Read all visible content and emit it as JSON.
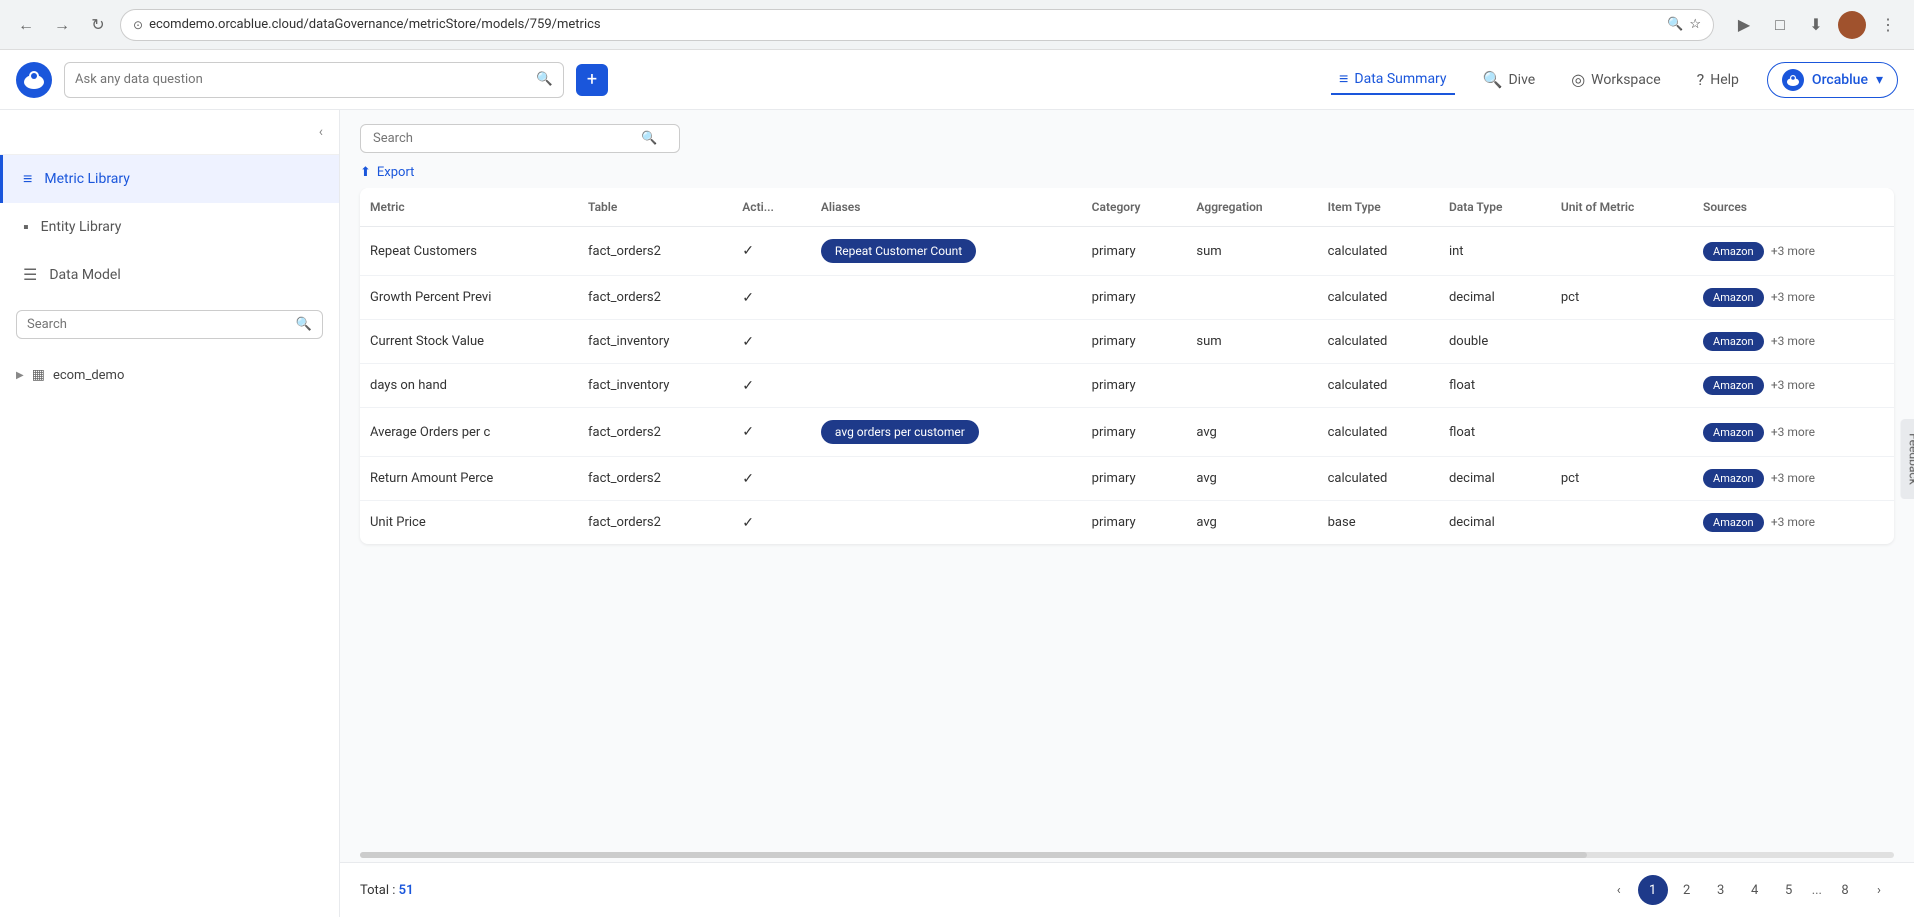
{
  "browser": {
    "url": "ecomdemo.orcablue.cloud/dataGovernance/metricStore/models/759/metrics",
    "back_label": "←",
    "forward_label": "→",
    "reload_label": "↻"
  },
  "header": {
    "search_placeholder": "Ask any data question",
    "nav": {
      "data_summary": "Data Summary",
      "dive": "Dive",
      "workspace": "Workspace",
      "help": "Help",
      "orcablue": "Orcablue"
    }
  },
  "sidebar": {
    "collapse_icon": "‹",
    "nav_items": [
      {
        "id": "metric-library",
        "label": "Metric Library",
        "icon": "≡",
        "active": true
      },
      {
        "id": "entity-library",
        "label": "Entity Library",
        "icon": "▪",
        "active": false
      },
      {
        "id": "data-model",
        "label": "Data Model",
        "icon": "☰",
        "active": false
      }
    ],
    "search_placeholder": "Search",
    "tree": {
      "item_label": "ecom_demo",
      "item_icon": "▦",
      "expand_icon": "▶"
    }
  },
  "content": {
    "search_placeholder": "Search",
    "export_label": "Export",
    "columns": [
      "Metric",
      "Table",
      "Acti...",
      "Aliases",
      "Category",
      "Aggregation",
      "Item Type",
      "Data Type",
      "Unit of Metric",
      "Sources"
    ],
    "rows": [
      {
        "metric": "Repeat Customers",
        "table": "fact_orders2",
        "active": true,
        "alias": "Repeat Customer Count",
        "category": "primary",
        "aggregation": "sum",
        "item_type": "calculated",
        "data_type": "int",
        "unit": "",
        "source": "Amazon",
        "more": "+3 more"
      },
      {
        "metric": "Growth Percent Previ",
        "table": "fact_orders2",
        "active": true,
        "alias": "",
        "category": "primary",
        "aggregation": "",
        "item_type": "calculated",
        "data_type": "decimal",
        "unit": "pct",
        "source": "Amazon",
        "more": "+3 more"
      },
      {
        "metric": "Current Stock Value",
        "table": "fact_inventory",
        "active": true,
        "alias": "",
        "category": "primary",
        "aggregation": "sum",
        "item_type": "calculated",
        "data_type": "double",
        "unit": "",
        "source": "Amazon",
        "more": "+3 more"
      },
      {
        "metric": "days on hand",
        "table": "fact_inventory",
        "active": true,
        "alias": "",
        "category": "primary",
        "aggregation": "",
        "item_type": "calculated",
        "data_type": "float",
        "unit": "",
        "source": "Amazon",
        "more": "+3 more"
      },
      {
        "metric": "Average Orders per c",
        "table": "fact_orders2",
        "active": true,
        "alias": "avg orders per customer",
        "category": "primary",
        "aggregation": "avg",
        "item_type": "calculated",
        "data_type": "float",
        "unit": "",
        "source": "Amazon",
        "more": "+3 more"
      },
      {
        "metric": "Return Amount Perce",
        "table": "fact_orders2",
        "active": true,
        "alias": "",
        "category": "primary",
        "aggregation": "avg",
        "item_type": "calculated",
        "data_type": "decimal",
        "unit": "pct",
        "source": "Amazon",
        "more": "+3 more"
      },
      {
        "metric": "Unit Price",
        "table": "fact_orders2",
        "active": true,
        "alias": "",
        "category": "primary",
        "aggregation": "avg",
        "item_type": "base",
        "data_type": "decimal",
        "unit": "",
        "source": "Amazon",
        "more": "+3 more"
      }
    ],
    "footer": {
      "total_label": "Total : ",
      "total_count": "51"
    },
    "pagination": {
      "prev": "‹",
      "next": "›",
      "pages": [
        "1",
        "2",
        "3",
        "4",
        "5",
        "...",
        "8"
      ],
      "active_page": "1"
    }
  },
  "feedback": {
    "label": "Feedback"
  }
}
